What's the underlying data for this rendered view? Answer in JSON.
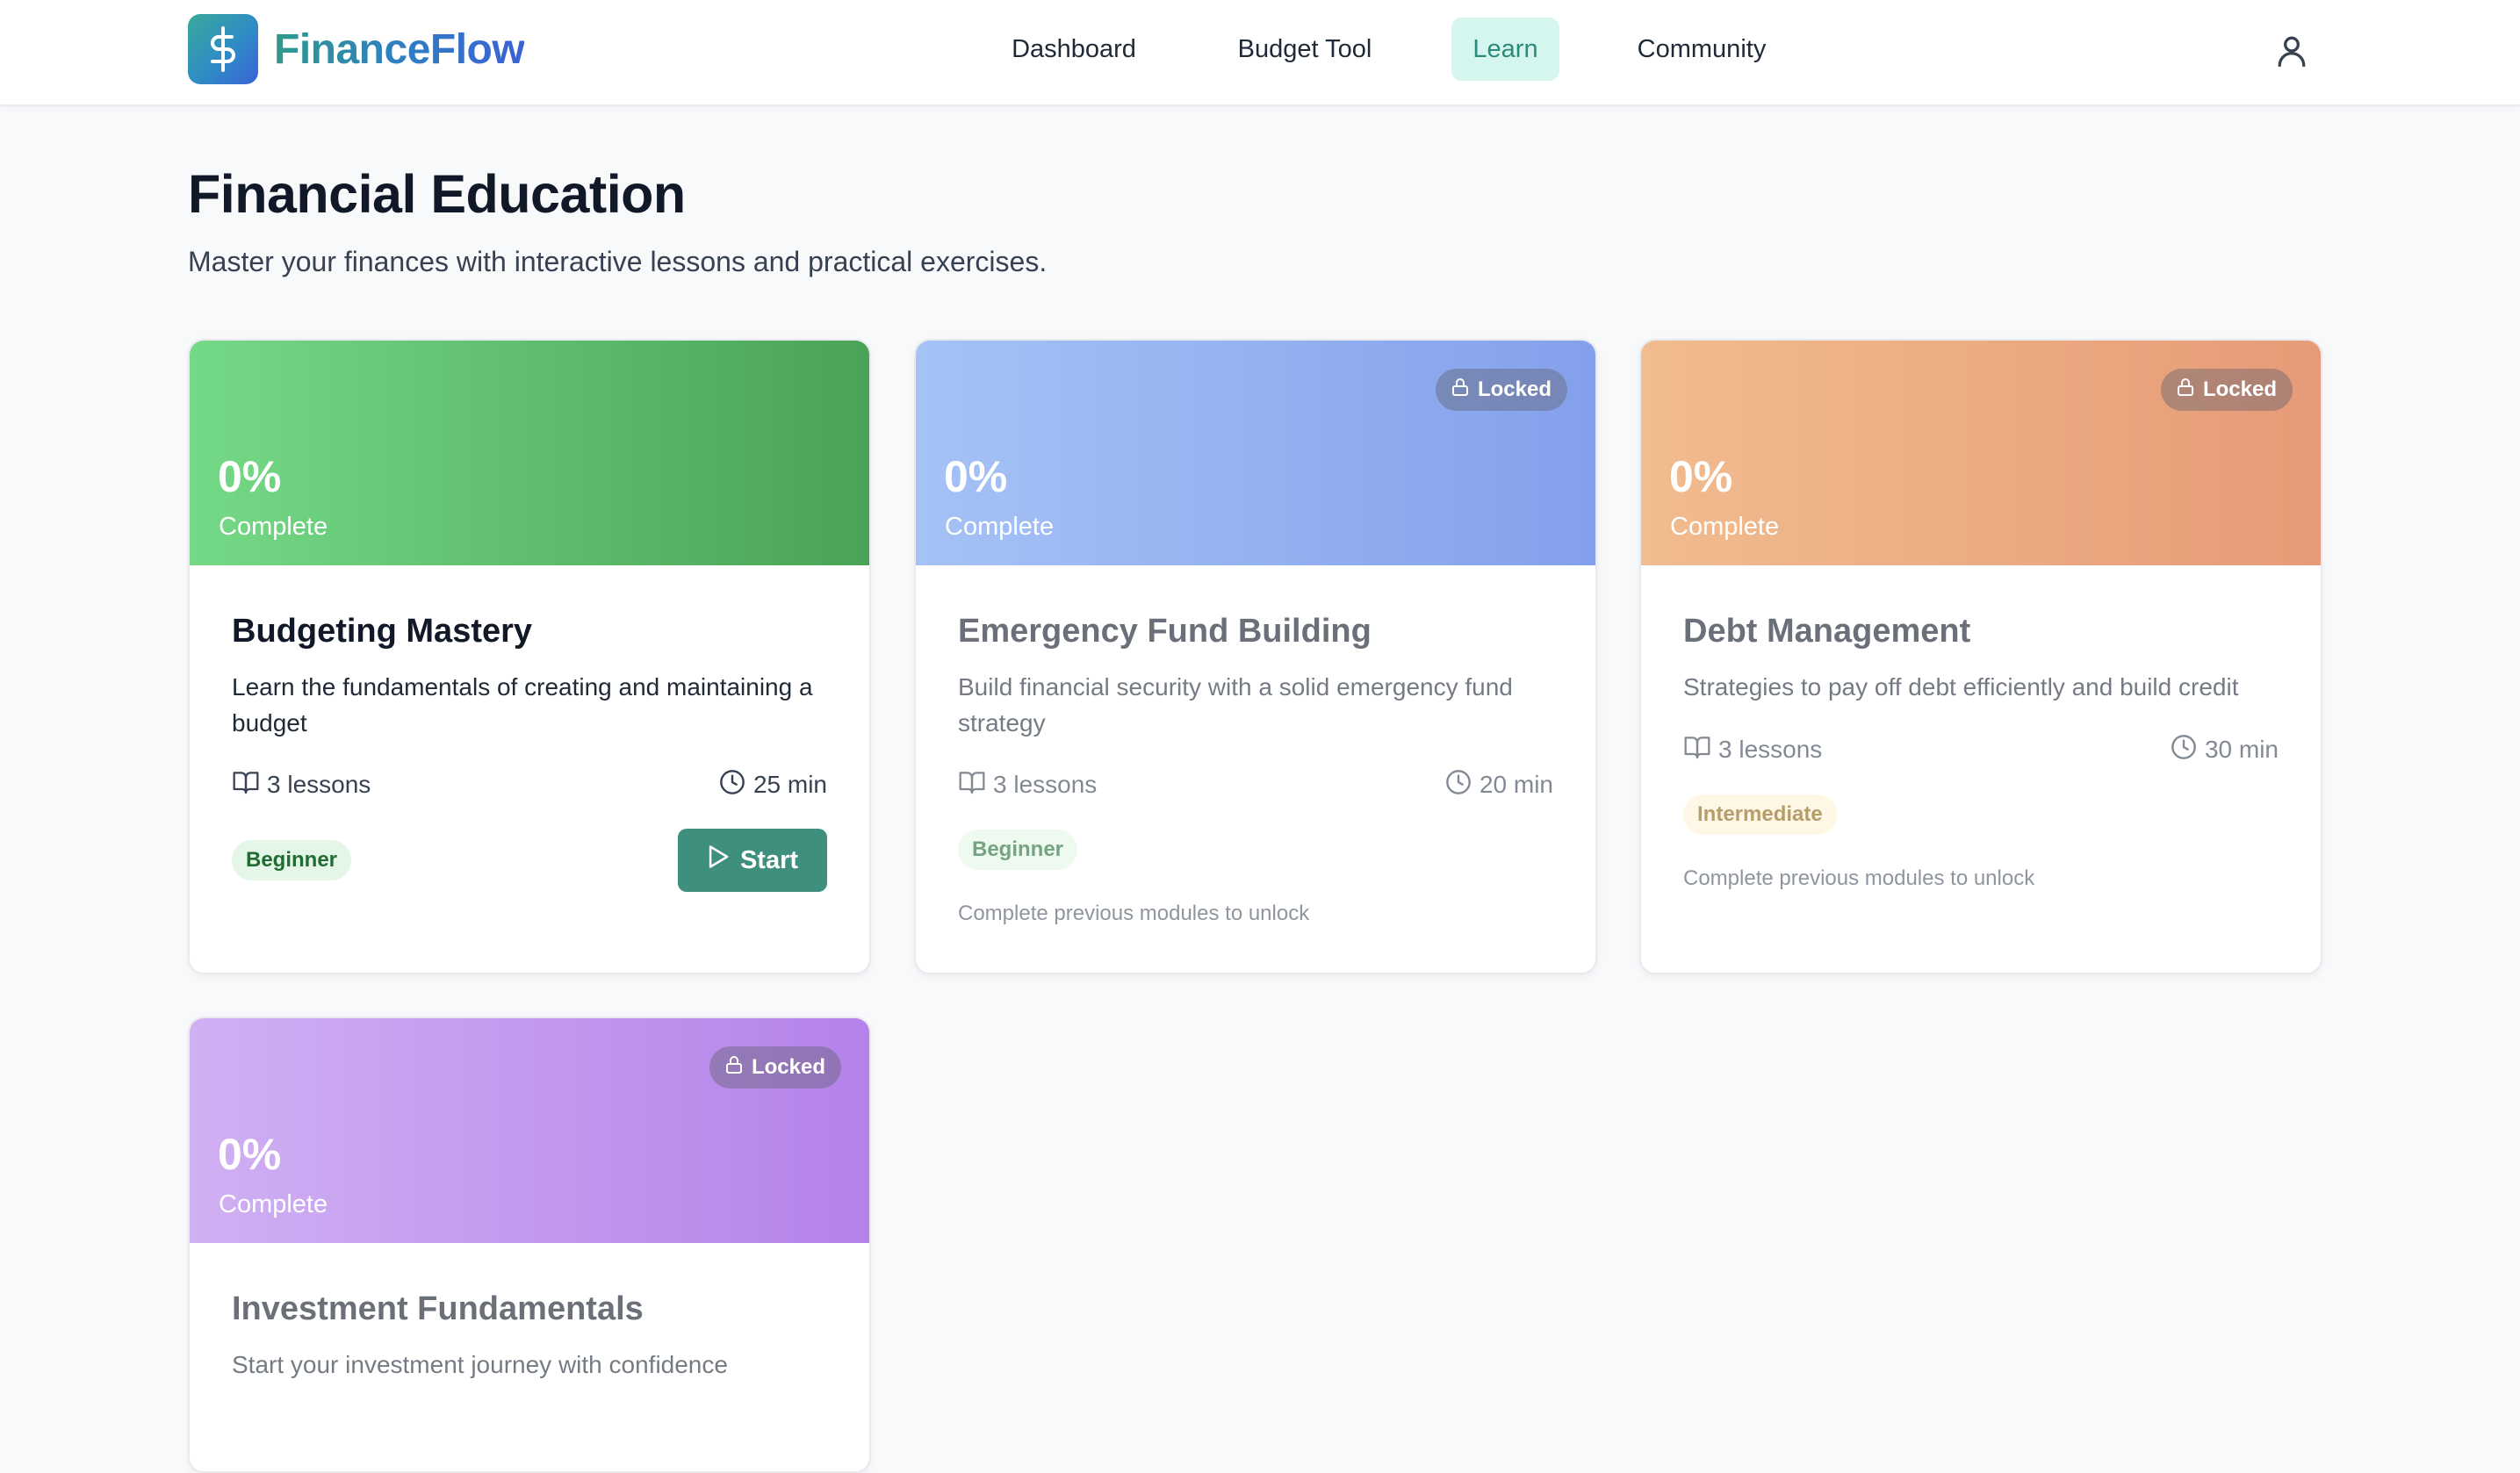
{
  "brand": {
    "name": "FinanceFlow",
    "logo_icon": "dollar-icon",
    "accent": "#2f7fc2"
  },
  "nav": {
    "items": [
      {
        "label": "Dashboard",
        "active": false
      },
      {
        "label": "Budget Tool",
        "active": false
      },
      {
        "label": "Learn",
        "active": true
      },
      {
        "label": "Community",
        "active": false
      }
    ],
    "user_icon": "user-icon"
  },
  "page": {
    "title": "Financial Education",
    "subtitle": "Master your finances with interactive lessons and practical exercises."
  },
  "courses": [
    {
      "title": "Budgeting Mastery",
      "description": "Learn the fundamentals of creating and maintaining a budget",
      "progress": "0%",
      "progress_label": "Complete",
      "lessons": "3 lessons",
      "duration": "25 min",
      "level": "Beginner",
      "locked": false,
      "action_label": "Start",
      "banner_color": "#5fbf70"
    },
    {
      "title": "Emergency Fund Building",
      "description": "Build financial security with a solid emergency fund strategy",
      "progress": "0%",
      "progress_label": "Complete",
      "lessons": "3 lessons",
      "duration": "20 min",
      "level": "Beginner",
      "locked": true,
      "locked_label": "Locked",
      "unlock_note": "Complete previous modules to unlock",
      "banner_color": "#94b1f1"
    },
    {
      "title": "Debt Management",
      "description": "Strategies to pay off debt efficiently and build credit",
      "progress": "0%",
      "progress_label": "Complete",
      "lessons": "3 lessons",
      "duration": "30 min",
      "level": "Intermediate",
      "locked": true,
      "locked_label": "Locked",
      "unlock_note": "Complete previous modules to unlock",
      "banner_color": "#ecab83"
    },
    {
      "title": "Investment Fundamentals",
      "description": "Start your investment journey with confidence",
      "progress": "0%",
      "progress_label": "Complete",
      "locked": true,
      "locked_label": "Locked",
      "banner_color": "#c299ee"
    }
  ]
}
